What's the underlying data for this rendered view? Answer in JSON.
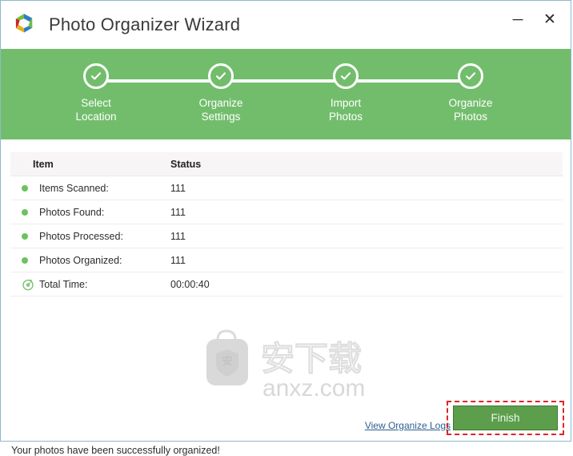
{
  "window": {
    "title": "Photo Organizer Wizard",
    "logo_icon": "hexagon-swirl-logo",
    "controls": [
      {
        "name": "minimize",
        "icon": "minimize-icon",
        "glyph": "─"
      },
      {
        "name": "close",
        "icon": "close-icon",
        "glyph": "✕"
      }
    ]
  },
  "stepper": {
    "accent_color": "#72bd6c",
    "steps": [
      {
        "label": "Select\nLocation",
        "icon": "check-circle-icon",
        "completed": true
      },
      {
        "label": "Organize\nSettings",
        "icon": "check-circle-icon",
        "completed": true
      },
      {
        "label": "Import\nPhotos",
        "icon": "check-circle-icon",
        "completed": true
      },
      {
        "label": "Organize\nPhotos",
        "icon": "check-circle-icon",
        "completed": true
      }
    ]
  },
  "results_table": {
    "columns": [
      "Item",
      "Status"
    ],
    "rows": [
      {
        "icon": "green-dot-icon",
        "item": "Items Scanned:",
        "status": "111"
      },
      {
        "icon": "green-dot-icon",
        "item": "Photos Found:",
        "status": "111"
      },
      {
        "icon": "green-dot-icon",
        "item": "Photos Processed:",
        "status": "111"
      },
      {
        "icon": "green-dot-icon",
        "item": "Photos Organized:",
        "status": "111"
      },
      {
        "icon": "stopwatch-icon",
        "item": "Total Time:",
        "status": "00:00:40"
      }
    ]
  },
  "message": "Your photos have been successfully organized!",
  "footer": {
    "logs_link": "View Organize Logs",
    "finish_label": "Finish",
    "finish_color": "#5c9e4c",
    "highlight_color": "#e02424"
  },
  "watermark": {
    "text": "anxz.com",
    "badge_char": "安",
    "cn_text": "安下载"
  }
}
